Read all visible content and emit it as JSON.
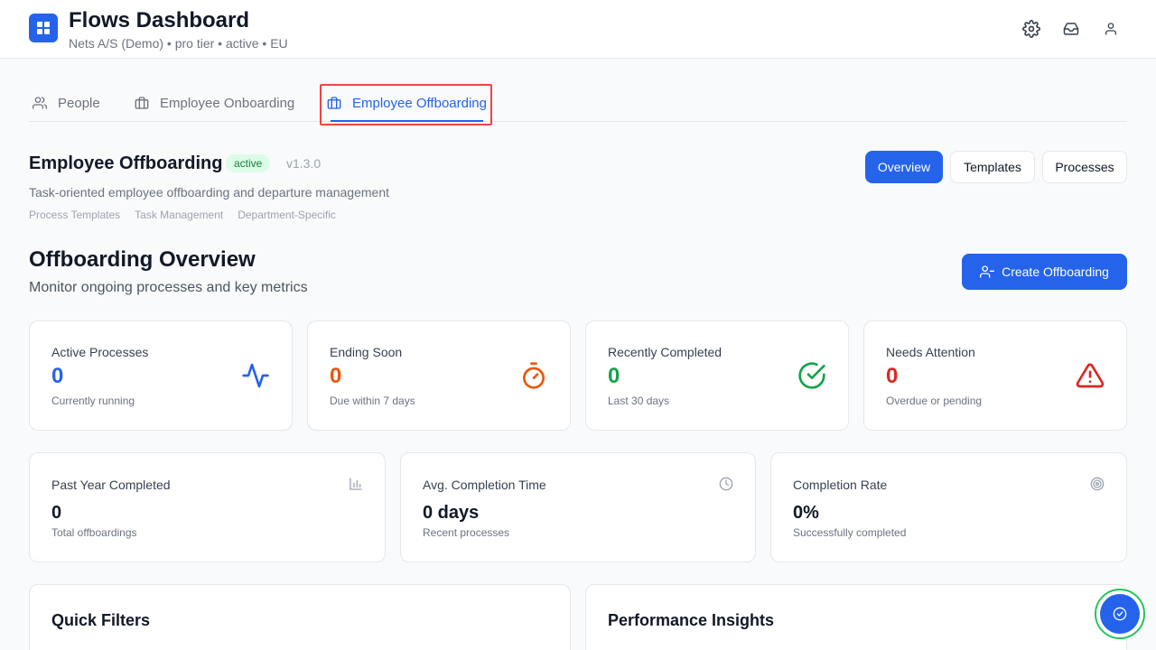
{
  "header": {
    "title": "Flows Dashboard",
    "subtitle": "Nets A/S (Demo) • pro tier • active • EU",
    "icons": [
      "settings-icon",
      "inbox-icon",
      "user-icon"
    ]
  },
  "tabs": [
    {
      "label": "People",
      "icon": "users-icon",
      "active": false
    },
    {
      "label": "Employee Onboarding",
      "icon": "briefcase-icon",
      "active": false
    },
    {
      "label": "Employee Offboarding",
      "icon": "briefcase-icon",
      "active": true
    }
  ],
  "module": {
    "title": "Employee Offboarding",
    "status": "active",
    "version": "v1.3.0",
    "description": "Task-oriented employee offboarding and departure management",
    "tags": [
      "Process Templates",
      "Task Management",
      "Department-Specific"
    ]
  },
  "view_buttons": [
    {
      "label": "Overview",
      "selected": true
    },
    {
      "label": "Templates",
      "selected": false
    },
    {
      "label": "Processes",
      "selected": false
    }
  ],
  "overview": {
    "title": "Offboarding Overview",
    "subtitle": "Monitor ongoing processes and key metrics",
    "create_label": "Create Offboarding"
  },
  "stats": [
    {
      "label": "Active Processes",
      "value": "0",
      "sub": "Currently running",
      "color": "#2563eb",
      "icon": "activity-icon"
    },
    {
      "label": "Ending Soon",
      "value": "0",
      "sub": "Due within 7 days",
      "color": "#ea580c",
      "icon": "timer-icon"
    },
    {
      "label": "Recently Completed",
      "value": "0",
      "sub": "Last 30 days",
      "color": "#16a34a",
      "icon": "check-circle-icon"
    },
    {
      "label": "Needs Attention",
      "value": "0",
      "sub": "Overdue or pending",
      "color": "#dc2626",
      "icon": "alert-triangle-icon"
    }
  ],
  "metrics": [
    {
      "label": "Past Year Completed",
      "value": "0",
      "sub": "Total offboardings",
      "icon": "bar-chart-icon"
    },
    {
      "label": "Avg. Completion Time",
      "value": "0 days",
      "sub": "Recent processes",
      "icon": "clock-icon"
    },
    {
      "label": "Completion Rate",
      "value": "0%",
      "sub": "Successfully completed",
      "icon": "target-icon"
    }
  ],
  "panels": [
    {
      "title": "Quick Filters"
    },
    {
      "title": "Performance Insights"
    }
  ],
  "colors": {
    "accent": "#2563eb",
    "highlight": "#ef4444",
    "badge_bg": "#dcfce7",
    "badge_fg": "#15803d",
    "fab_ring": "#22c55e"
  }
}
